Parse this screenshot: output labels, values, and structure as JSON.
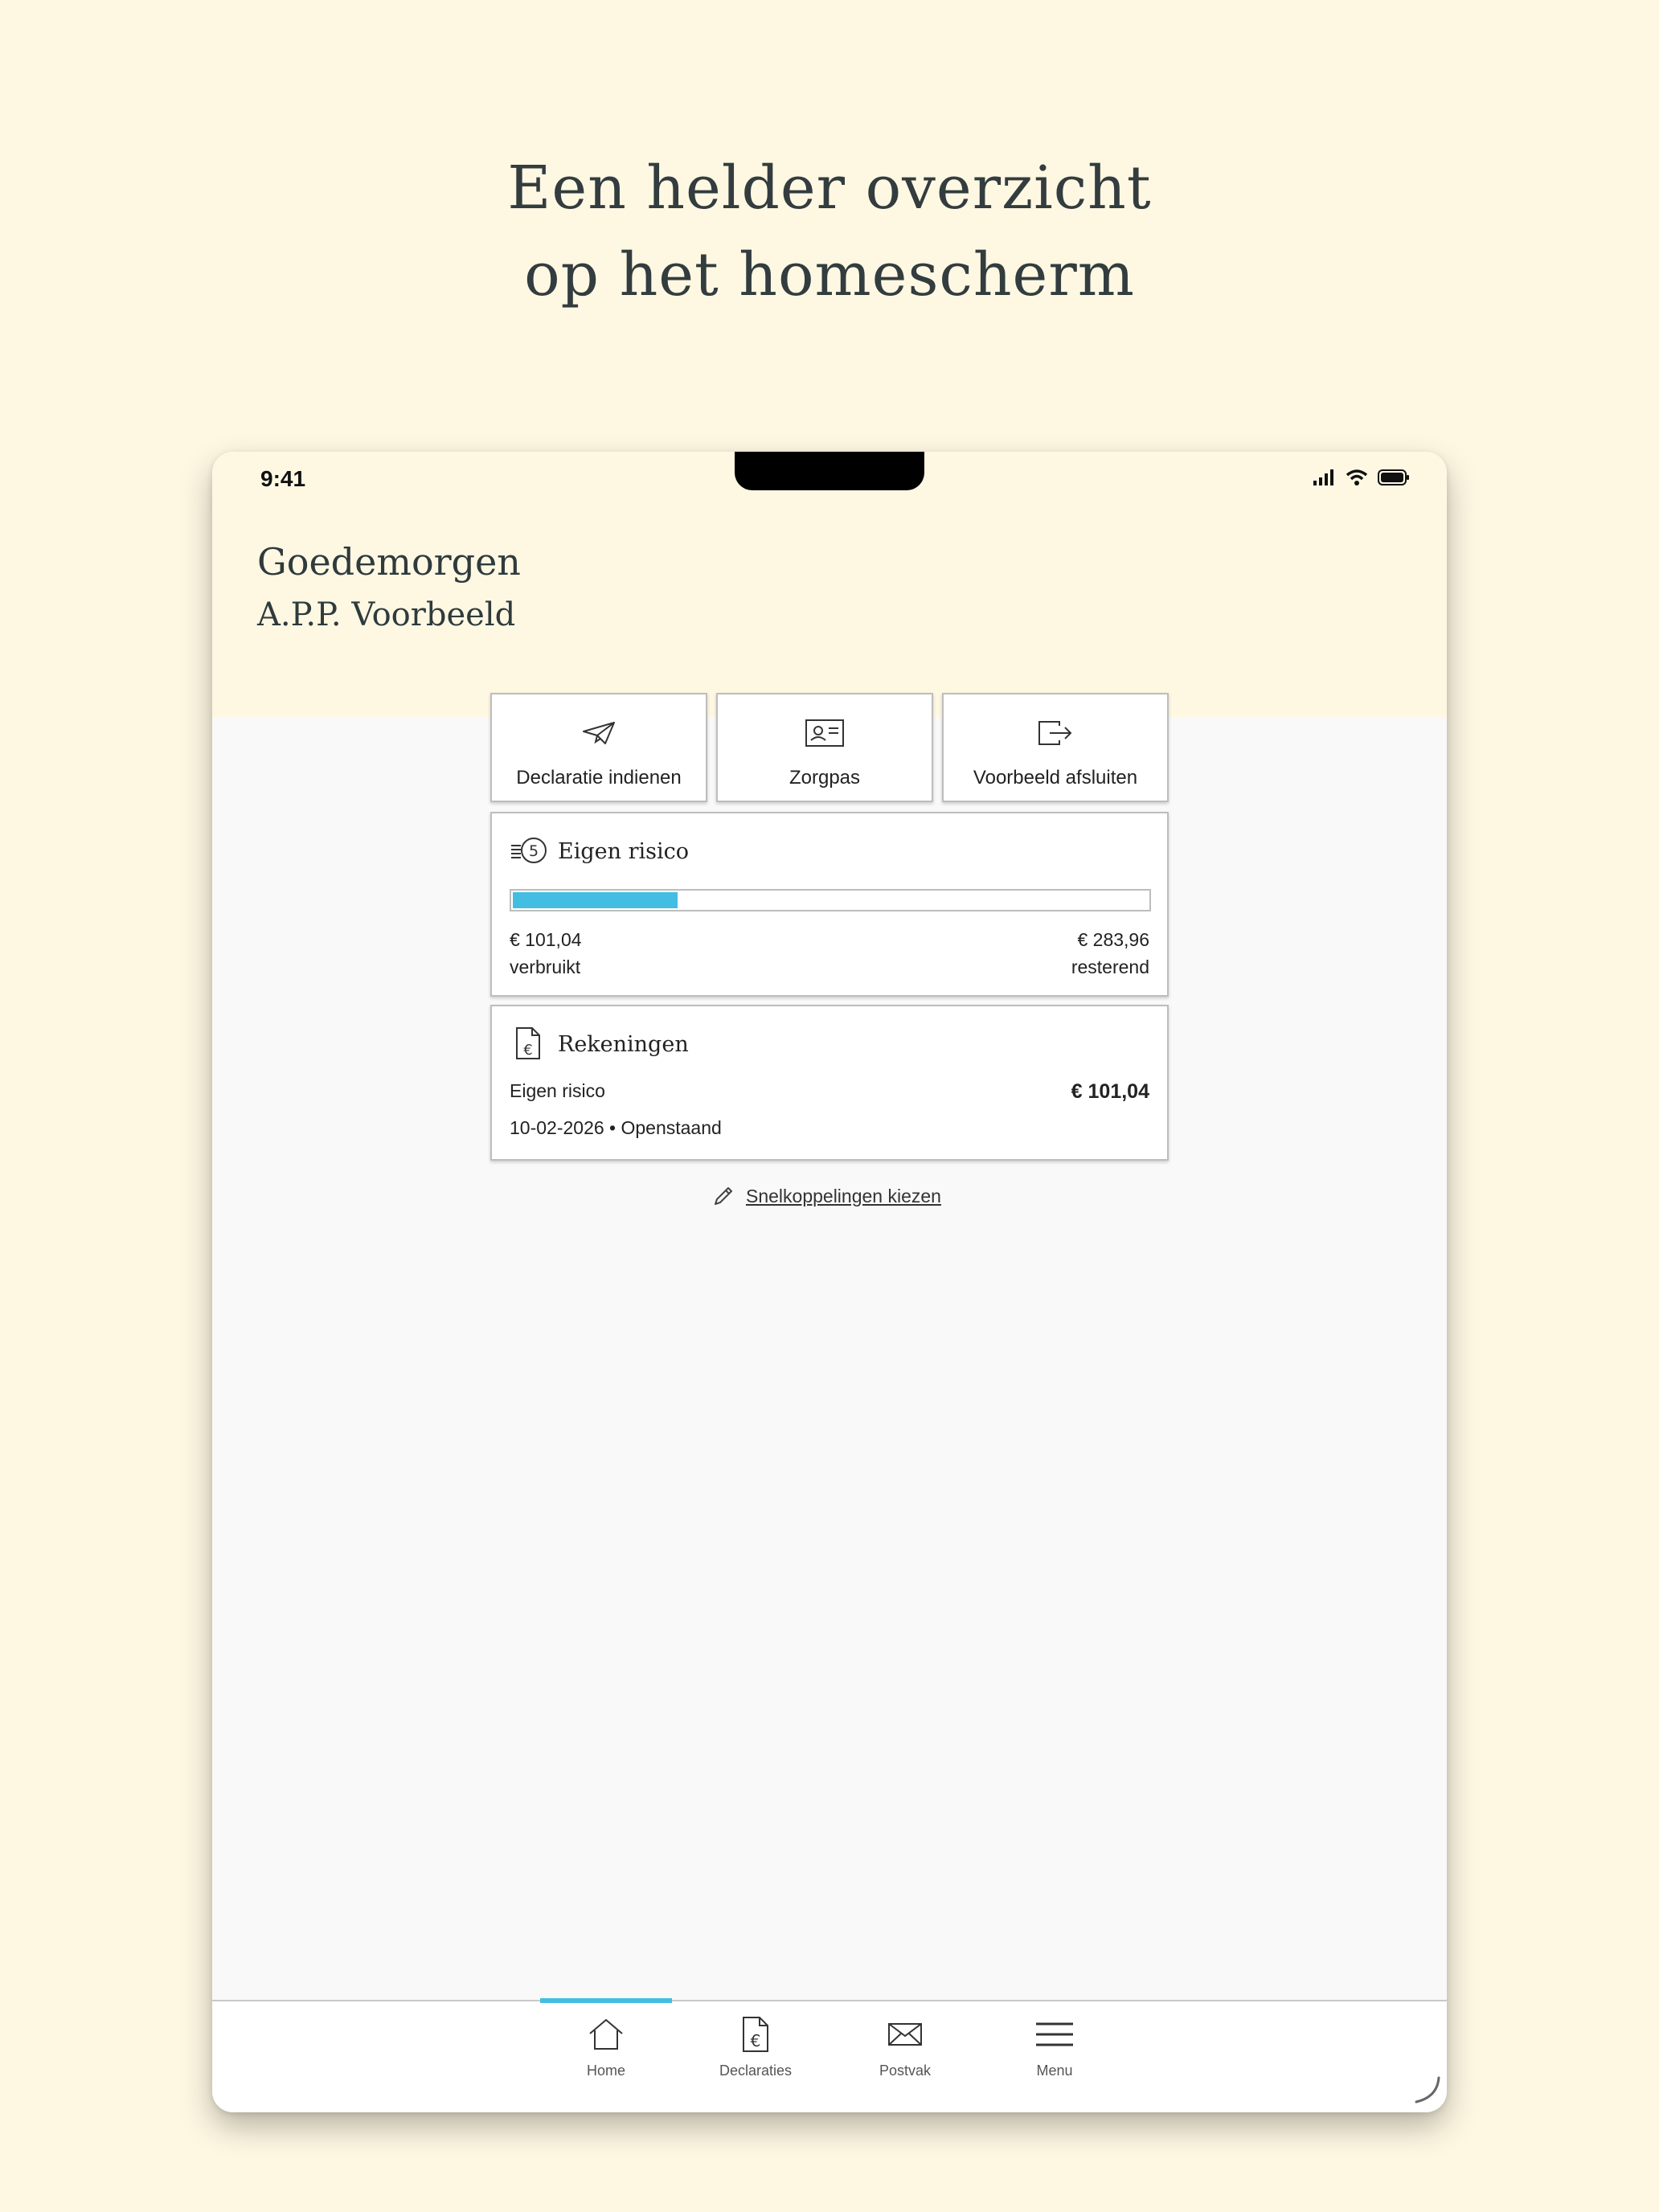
{
  "promo": {
    "headline_line1": "Een helder overzicht",
    "headline_line2": "op het homescherm"
  },
  "status_bar": {
    "time": "9:41",
    "icons": [
      "cellular-signal-icon",
      "wifi-icon",
      "battery-icon"
    ]
  },
  "header": {
    "greeting": "Goedemorgen",
    "user_name": "A.P.P. Voorbeeld"
  },
  "quick_actions": [
    {
      "label": "Declaratie indienen",
      "icon": "paper-plane-icon"
    },
    {
      "label": "Zorgpas",
      "icon": "id-card-icon"
    },
    {
      "label": "Voorbeeld afsluiten",
      "icon": "exit-icon"
    }
  ],
  "deductible": {
    "title": "Eigen risico",
    "icon": "coins-icon",
    "used_amount": "€ 101,04",
    "used_label": "verbruikt",
    "remaining_amount": "€ 283,96",
    "remaining_label": "resterend",
    "progress_fraction": 0.263,
    "progress_color": "#44bde3"
  },
  "invoices": {
    "title": "Rekeningen",
    "icon": "invoice-euro-icon",
    "item_name": "Eigen risico",
    "item_amount": "€ 101,04",
    "item_meta": "10-02-2026 • Openstaand"
  },
  "shortcuts_link": {
    "label": "Snelkoppelingen kiezen",
    "icon": "pencil-icon"
  },
  "tabbar": {
    "active_color": "#44bde3",
    "items": [
      {
        "label": "Home",
        "icon": "home-icon",
        "active": true
      },
      {
        "label": "Declaraties",
        "icon": "declaration-document-icon",
        "active": false
      },
      {
        "label": "Postvak",
        "icon": "envelope-icon",
        "active": false
      },
      {
        "label": "Menu",
        "icon": "hamburger-menu-icon",
        "active": false
      }
    ]
  }
}
